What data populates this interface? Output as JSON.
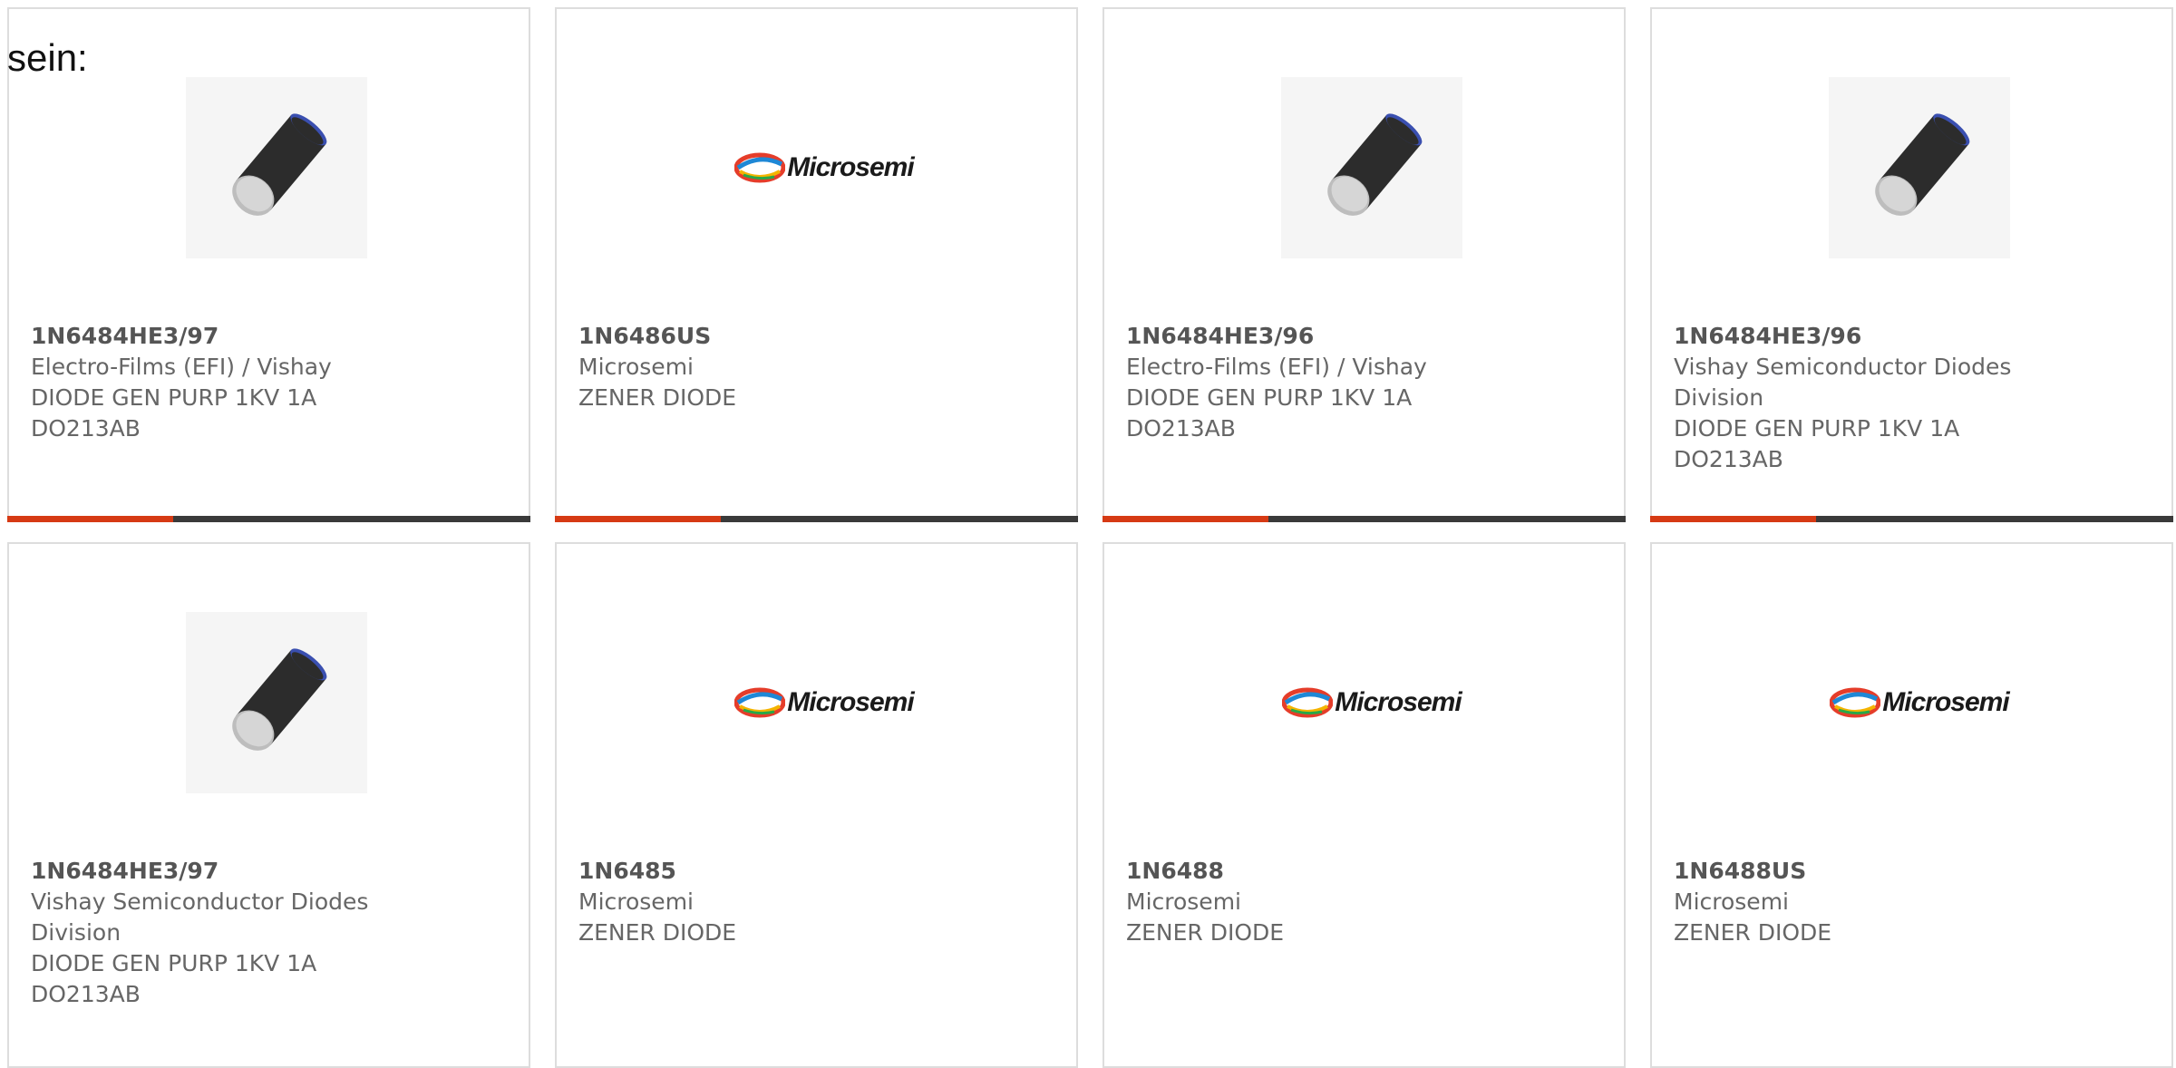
{
  "page": {
    "prefix": "sein:"
  },
  "cards": [
    {
      "part": "1N6484HE3/97",
      "manufacturer": "Electro-Films (EFI) / Vishay",
      "description": "DIODE GEN PURP 1KV 1A DO213AB",
      "image": "diode-image"
    },
    {
      "part": "1N6486US",
      "manufacturer": "Microsemi",
      "description": "ZENER DIODE",
      "image": "microsemi-logo",
      "logo_text": "Microsemi"
    },
    {
      "part": "1N6484HE3/96",
      "manufacturer": "Electro-Films (EFI) / Vishay",
      "description": "DIODE GEN PURP 1KV 1A DO213AB",
      "image": "diode-image"
    },
    {
      "part": "1N6484HE3/96",
      "manufacturer": "Vishay Semiconductor Diodes Division",
      "description": "DIODE GEN PURP 1KV 1A DO213AB",
      "image": "diode-image"
    },
    {
      "part": "1N6484HE3/97",
      "manufacturer": "Vishay Semiconductor Diodes Division",
      "description": "DIODE GEN PURP 1KV 1A DO213AB",
      "image": "diode-image"
    },
    {
      "part": "1N6485",
      "manufacturer": "Microsemi",
      "description": "ZENER DIODE",
      "image": "microsemi-logo",
      "logo_text": "Microsemi"
    },
    {
      "part": "1N6488",
      "manufacturer": "Microsemi",
      "description": "ZENER DIODE",
      "image": "microsemi-logo",
      "logo_text": "Microsemi"
    },
    {
      "part": "1N6488US",
      "manufacturer": "Microsemi",
      "description": "ZENER DIODE",
      "image": "microsemi-logo",
      "logo_text": "Microsemi"
    }
  ],
  "colors": {
    "accent": "#d63a14",
    "bar": "#3a3a3a",
    "border": "#dddddd",
    "text": "#666666"
  }
}
